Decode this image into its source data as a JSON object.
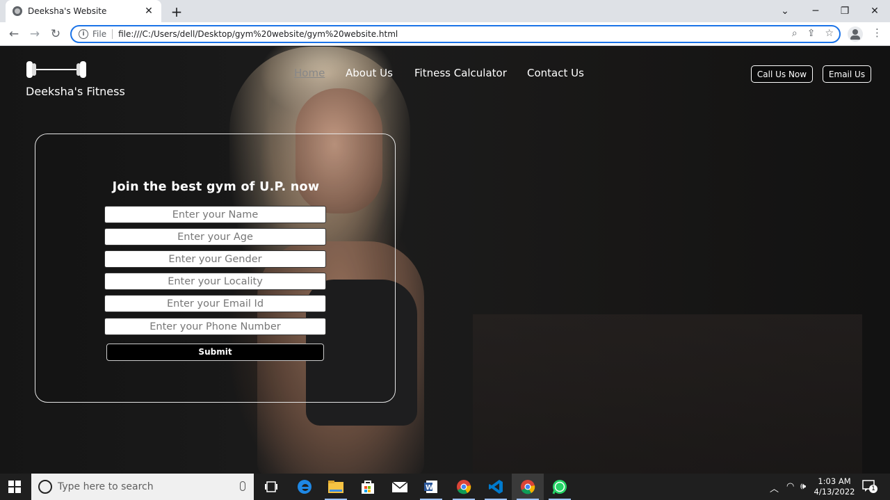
{
  "browser": {
    "tab_title": "Deeksha's Website",
    "new_tab": "+",
    "url_scheme": "File",
    "url": "file:///C:/Users/dell/Desktop/gym%20website/gym%20website.html"
  },
  "site": {
    "brand": "Deeksha's Fitness",
    "nav": {
      "home": "Home",
      "about": "About Us",
      "calculator": "Fitness Calculator",
      "contact": "Contact Us"
    },
    "buttons": {
      "call": "Call Us Now",
      "email": "Email Us"
    }
  },
  "form": {
    "title": "Join the best gym of U.P. now",
    "fields": {
      "name": "Enter your Name",
      "age": "Enter your Age",
      "gender": "Enter your Gender",
      "locality": "Enter your Locality",
      "email": "Enter your Email Id",
      "phone": "Enter your Phone Number"
    },
    "submit": "Submit"
  },
  "taskbar": {
    "search_placeholder": "Type here to search",
    "time": "1:03 AM",
    "date": "4/13/2022",
    "notification_count": "1"
  },
  "colors": {
    "omnibox_border": "#1a73e8",
    "page_bg": "#1a1a1a",
    "taskbar_bg": "#1f1f1f"
  }
}
